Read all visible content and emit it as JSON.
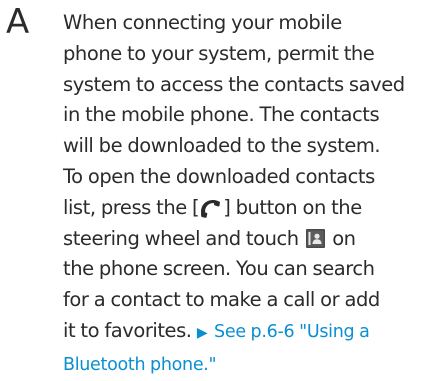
{
  "answer": {
    "letter": "A",
    "lines": [
      "When connecting your mobile",
      "phone to your system, permit the",
      "system to access the contacts saved",
      "in the mobile phone. The contacts",
      "will be downloaded to the system.",
      "To open the downloaded contacts"
    ],
    "line7_before": "list, press the [",
    "line7_after": "] button on the",
    "line8_before": "steering wheel and touch",
    "line8_after": "on",
    "line9": "the phone screen. You can search",
    "line10": "for a contact to make a call or add",
    "line11_text": "it to favorites.",
    "reference_part1": "See p.6-6 \"Using a",
    "reference_part2": "Bluetooth phone.\""
  },
  "icons": {
    "call_button": "phone-handset-icon",
    "contacts_button": "contacts-icon",
    "reference_arrow": "triangle-right-icon"
  },
  "colors": {
    "text": "#2b2b2b",
    "link": "#0a8fd1",
    "icon_bg": "#4a4a4a"
  }
}
